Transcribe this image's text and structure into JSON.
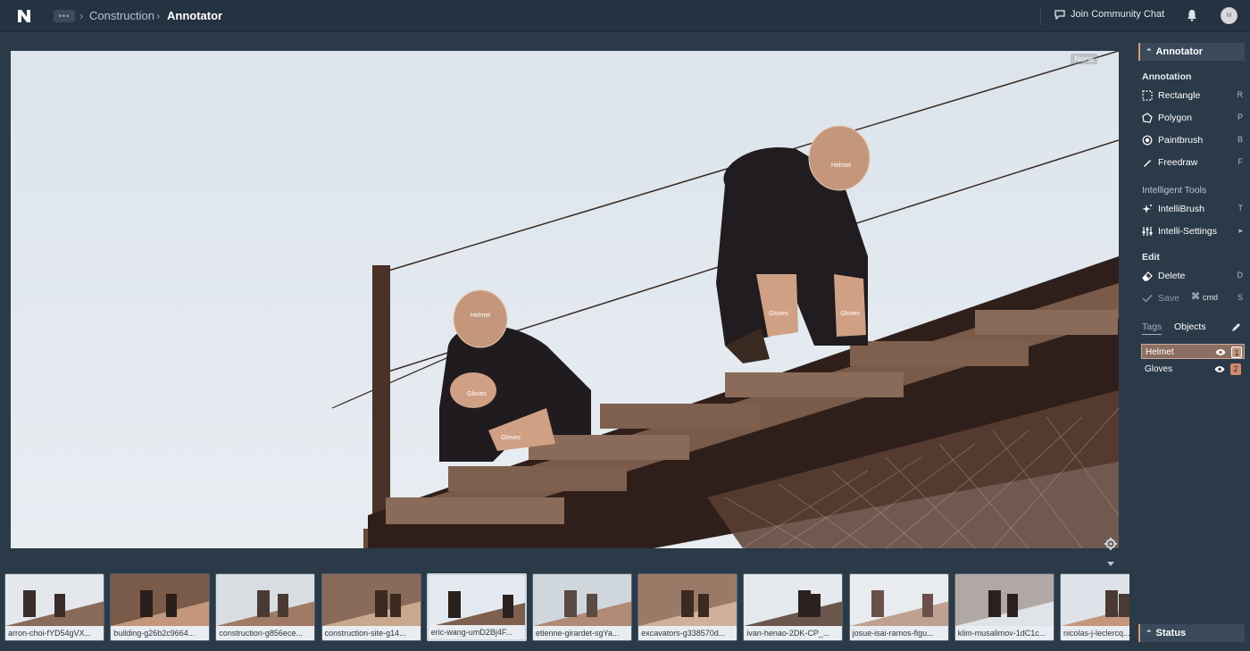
{
  "topbar": {
    "more_label": "•••",
    "breadcrumb_sep": "›",
    "project": "Construction",
    "current": "Annotator",
    "community_label": "Join Community Chat",
    "avatar_initials": "M"
  },
  "canvas": {
    "mode_badge": "None",
    "labels": {
      "helmet": "Helmet",
      "gloves": "Gloves"
    }
  },
  "panel": {
    "header": "Annotator",
    "annotation_title": "Annotation",
    "tools": [
      {
        "label": "Rectangle",
        "key": "R",
        "icon": "rectangle-icon"
      },
      {
        "label": "Polygon",
        "key": "P",
        "icon": "polygon-icon"
      },
      {
        "label": "Paintbrush",
        "key": "B",
        "icon": "paintbrush-icon"
      },
      {
        "label": "Freedraw",
        "key": "F",
        "icon": "freedraw-icon"
      }
    ],
    "intelligent_title": "Intelligent Tools",
    "intelligent_tools": [
      {
        "label": "IntelliBrush",
        "key": "T",
        "icon": "sparkle-icon"
      },
      {
        "label": "Intelli-Settings",
        "key": "▸",
        "icon": "sliders-icon"
      }
    ],
    "edit_title": "Edit",
    "edit_tools": [
      {
        "label": "Delete",
        "key": "D",
        "icon": "eraser-icon"
      },
      {
        "label": "Save",
        "key": "S",
        "icon": "check-icon",
        "modifier": "cmd"
      }
    ],
    "tabs": {
      "tags": "Tags",
      "objects": "Objects"
    },
    "tags": [
      {
        "name": "Helmet",
        "number": "1",
        "color": "#c4977c",
        "selected": true
      },
      {
        "name": "Gloves",
        "number": "2",
        "color": "#d08a6e",
        "selected": false
      }
    ],
    "status_header": "Status"
  },
  "filmstrip": [
    {
      "caption": "arron-choi-fYD54gVX...",
      "active": false
    },
    {
      "caption": "building-g26b2c9664...",
      "active": false
    },
    {
      "caption": "construction-g856ece...",
      "active": false
    },
    {
      "caption": "construction-site-g14...",
      "active": false
    },
    {
      "caption": "eric-wang-umD2Bj4F...",
      "active": true
    },
    {
      "caption": "etienne-girardet-sgYa...",
      "active": false
    },
    {
      "caption": "excavators-g338570d...",
      "active": false
    },
    {
      "caption": "ivan-henao-2DK-CP_...",
      "active": false
    },
    {
      "caption": "josue-isai-ramos-figu...",
      "active": false
    },
    {
      "caption": "klim-musalimov-1dC1c...",
      "active": false
    },
    {
      "caption": "nicolas-j-leclercq...",
      "active": false
    }
  ]
}
